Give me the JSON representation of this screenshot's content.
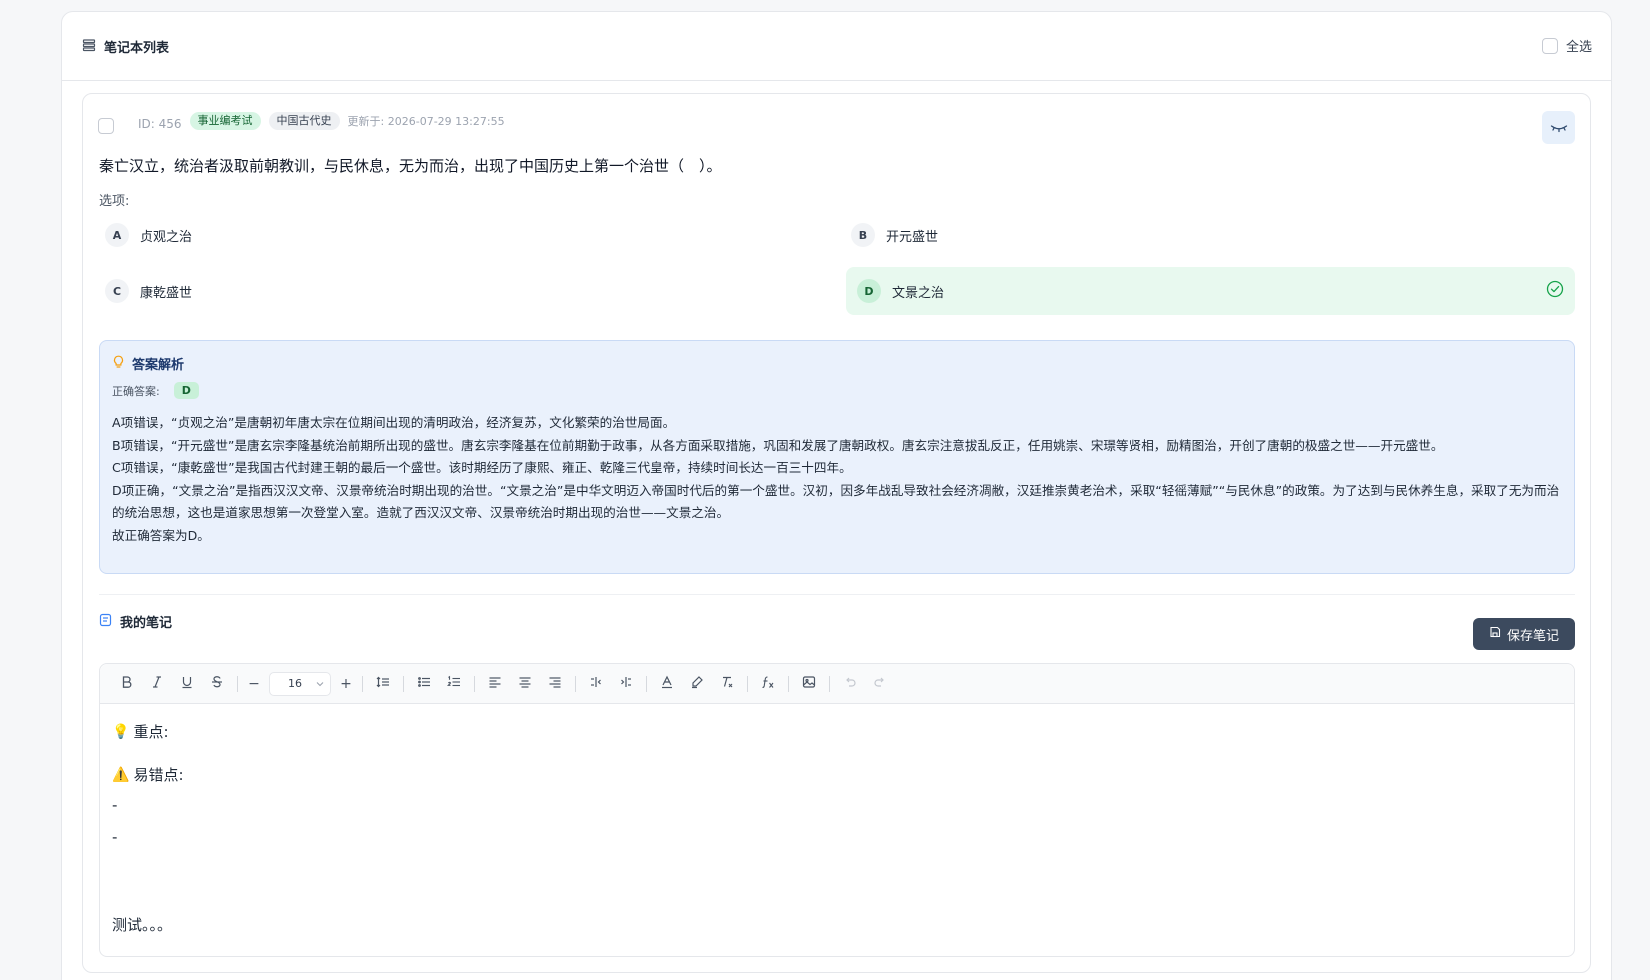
{
  "header": {
    "title": "笔记本列表",
    "select_all_label": "全选"
  },
  "card": {
    "id_label": "ID: 456",
    "tags": [
      "事业编考试",
      "中国古代史"
    ],
    "updated": "更新于: 2026-07-29 13:27:55",
    "question": "秦亡汉立，统治者汲取前朝教训，与民休息，无为而治，出现了中国历史上第一个治世（　）。",
    "options_label": "选项:",
    "options": [
      {
        "letter": "A",
        "text": "贞观之治"
      },
      {
        "letter": "B",
        "text": "开元盛世"
      },
      {
        "letter": "C",
        "text": "康乾盛世"
      },
      {
        "letter": "D",
        "text": "文景之治"
      }
    ],
    "correct_option": "D"
  },
  "analysis": {
    "title": "答案解析",
    "answer_label": "正确答案:",
    "answer": "D",
    "lines": [
      "A项错误，“贞观之治”是唐朝初年唐太宗在位期间出现的清明政治，经济复苏，文化繁荣的治世局面。",
      "B项错误，“开元盛世”是唐玄宗李隆基统治前期所出现的盛世。唐玄宗李隆基在位前期勤于政事，从各方面采取措施，巩固和发展了唐朝政权。唐玄宗注意拔乱反正，任用姚崇、宋璟等贤相，励精图治，开创了唐朝的极盛之世——开元盛世。",
      "C项错误，“康乾盛世”是我国古代封建王朝的最后一个盛世。该时期经历了康熙、雍正、乾隆三代皇帝，持续时间长达一百三十四年。",
      "D项正确，“文景之治”是指西汉汉文帝、汉景帝统治时期出现的治世。“文景之治”是中华文明迈入帝国时代后的第一个盛世。汉初，因多年战乱导致社会经济凋敝，汉廷推崇黄老治术，采取“轻徭薄赋”“与民休息”的政策。为了达到与民休养生息，采取了无为而治的统治思想，这也是道家思想第一次登堂入室。造就了西汉汉文帝、汉景帝统治时期出现的治世——文景之治。",
      "故正确答案为D。"
    ]
  },
  "notes": {
    "title": "我的笔记",
    "save_label": "保存笔记",
    "font_size": "16",
    "content": {
      "key_points_emoji": "💡",
      "key_points": "重点:",
      "pitfalls_emoji": "⚠️",
      "pitfalls": "易错点:",
      "bullet1": "-",
      "bullet2": "-",
      "test_text": "测试。。。"
    }
  },
  "colors": {
    "accent_dark": "#3c4a5e",
    "correct_bg": "#e8f9ef",
    "analysis_bg": "#eaf1fc",
    "tag_green": "#d7f5e4"
  }
}
